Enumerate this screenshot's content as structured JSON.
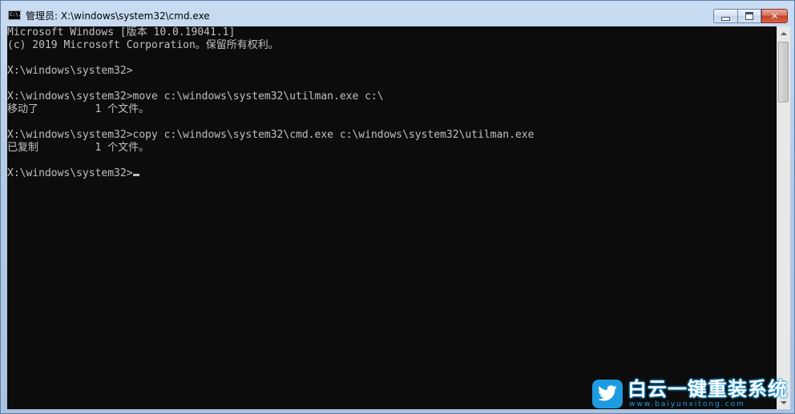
{
  "window": {
    "title": "管理员: X:\\windows\\system32\\cmd.exe",
    "icon_label": "C:\\."
  },
  "caption_buttons": {
    "minimize_icon": "minimize-icon",
    "maximize_icon": "maximize-icon",
    "close_icon": "close-icon",
    "close_glyph": "✕"
  },
  "console": {
    "lines": [
      "Microsoft Windows [版本 10.0.19041.1]",
      "(c) 2019 Microsoft Corporation。保留所有权利。",
      "",
      "X:\\windows\\system32>",
      "",
      "X:\\windows\\system32>move c:\\windows\\system32\\utilman.exe c:\\",
      "移动了         1 个文件。",
      "",
      "X:\\windows\\system32>copy c:\\windows\\system32\\cmd.exe c:\\windows\\system32\\utilman.exe",
      "已复制         1 个文件。",
      "",
      "X:\\windows\\system32>"
    ],
    "colors": {
      "background": "#0c0c0c",
      "text": "#c0c0c0"
    }
  },
  "watermark": {
    "title": "白云一键重装系统",
    "url": "www.baiyunxitong.com",
    "icon": "twitter-bird-icon",
    "color": "#1e9be0"
  }
}
